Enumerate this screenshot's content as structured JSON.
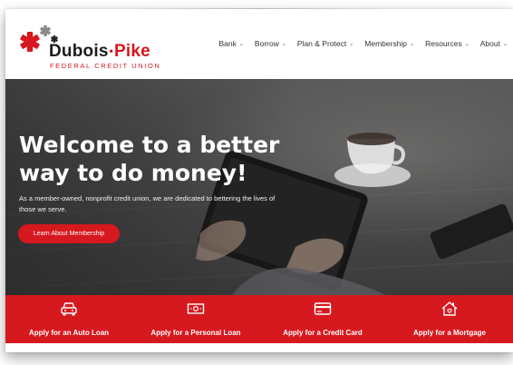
{
  "brand": {
    "name_part1": "Dubois",
    "separator": "•",
    "name_part2": "Pike",
    "tagline": "FEDERAL CREDIT UNION",
    "accent_color": "#d6181f",
    "logo_icon": "asterisk-marks-icon"
  },
  "nav": {
    "items": [
      {
        "label": "Bank"
      },
      {
        "label": "Borrow"
      },
      {
        "label": "Plan & Protect"
      },
      {
        "label": "Membership"
      },
      {
        "label": "Resources"
      },
      {
        "label": "About"
      }
    ],
    "caret": "⌄"
  },
  "hero": {
    "title": "Welcome to a better way to do money!",
    "subtitle": "As a member-owned, nonprofit credit union, we are dedicated to bettering the lives of those we serve.",
    "button_label": "Learn About Membership"
  },
  "actions": [
    {
      "label": "Apply for an Auto Loan",
      "icon": "car-icon"
    },
    {
      "label": "Apply for a Personal Loan",
      "icon": "cash-icon"
    },
    {
      "label": "Apply for a Credit Card",
      "icon": "credit-card-icon"
    },
    {
      "label": "Apply for a Mortgage",
      "icon": "house-icon"
    }
  ]
}
